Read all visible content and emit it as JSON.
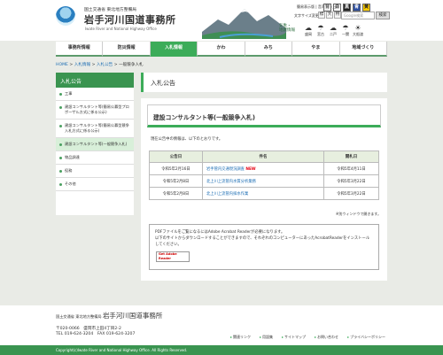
{
  "header": {
    "org_small": "国土交通省 東北地方整備局",
    "title": "岩手河川国道事務所",
    "title_en": "Iwate River and National Highway Office",
    "links": "簡易表示版 | 音声読み上げ",
    "font_size_label": "文字サイズ変更",
    "size_buttons": [
      "標",
      "大",
      "特"
    ],
    "search_placeholder": "Google検索",
    "search_button": "検索",
    "road_info": "気象・\n地震情報"
  },
  "tools": [
    "背",
    "白",
    "黒",
    "青",
    "黄"
  ],
  "weather": [
    {
      "icon": "☁",
      "label": "盛岡"
    },
    {
      "icon": "☂",
      "label": "宮古"
    },
    {
      "icon": "☁",
      "label": "二戸"
    },
    {
      "icon": "☂",
      "label": "一関"
    },
    {
      "icon": "☀",
      "label": "大船渡"
    }
  ],
  "nav": [
    "事務所情報",
    "防災情報",
    "入札情報",
    "かわ",
    "みち",
    "やま",
    "地域づくり"
  ],
  "nav_active": 2,
  "breadcrumb": {
    "home": "HOME",
    "l1": "入札情報",
    "l2": "入札公告",
    "current": "一般競争入札"
  },
  "sidebar": {
    "title": "入札公告",
    "items": [
      "工事",
      "建設コンサルタント等(簡易公募型プロポーザル方式に係る公示)",
      "建設コンサルタント等(簡易公募型競争入札方式に係る公示)",
      "建設コンサルタント等(一般競争入札)",
      "物品調達",
      "役務",
      "その他"
    ],
    "selected": 3
  },
  "page_title": "入札公告",
  "section_title": "建設コンサルタント等(一般競争入札)",
  "intro": "現在公告中の情報は、以下のとおりです。",
  "table": {
    "headers": [
      "公告日",
      "件名",
      "開札日"
    ],
    "rows": [
      {
        "date": "令和5年2月16日",
        "name": "岩手管内交通現況調査",
        "new": "NEW",
        "open": "令和5年4月11日"
      },
      {
        "date": "令和5年2月8日",
        "name": "北上川上流管内水質分析業務",
        "new": "",
        "open": "令和5年3月22日"
      },
      {
        "date": "令和5年2月8日",
        "name": "北上川上流管内採水作業",
        "new": "",
        "open": "令和5年3月22日"
      }
    ]
  },
  "window_note": "※別ウィンドウで開きます。",
  "pdf_note": {
    "line1": "PDFファイルをご覧になるにはAdobe Acrobat Readerが必要になります。",
    "line2": "以下のサイトからダウンロードすることができますので、それぞれのコンピューターにあったAcrobatReaderをインストールしてください。",
    "badge": "Get Adobe Reader"
  },
  "footer": {
    "org": "国土交通省 東北地方整備局",
    "name": "岩手河川国道事務所",
    "zip": "〒020-0066　盛岡市上田4丁目2-2",
    "tel": "TEL 019-624-3204　FAX 019-624-3207",
    "links": [
      "関連リンク",
      "用語集",
      "サイトマップ",
      "お問い合わせ",
      "プライバシーポリシー"
    ],
    "copyright": "Copyright(c)Iwate River and National Highway Office. All Rights Reserved."
  }
}
